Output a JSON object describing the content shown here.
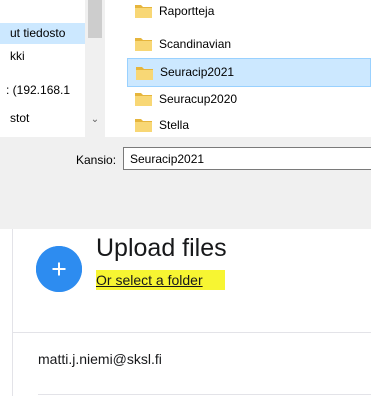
{
  "file_dialog": {
    "nav_items": [
      {
        "label": "ut tiedosto",
        "selected": true
      },
      {
        "label": "kki",
        "selected": false
      },
      {
        "label": ": (192.168.1",
        "selected": false
      },
      {
        "label": "stot",
        "selected": false
      }
    ],
    "folders": [
      {
        "name": "Raportteja",
        "selected": false
      },
      {
        "name": "Scandinavian",
        "selected": false
      },
      {
        "name": "Seuracip2021",
        "selected": true
      },
      {
        "name": "Seuracup2020",
        "selected": false
      },
      {
        "name": "Stella",
        "selected": false
      }
    ],
    "folder_field": {
      "label": "Kansio:",
      "value": "Seuracip2021"
    }
  },
  "upload": {
    "title": "Upload files",
    "select_folder_link": "Or select a folder",
    "highlight_color": "#f7f532",
    "accent_color": "#2d8cf0"
  },
  "account": {
    "email": "matti.j.niemi@sksl.fi"
  },
  "icons": {
    "folder": "folder-icon",
    "add": "plus-icon",
    "scroll": "chevron-down-icon"
  }
}
